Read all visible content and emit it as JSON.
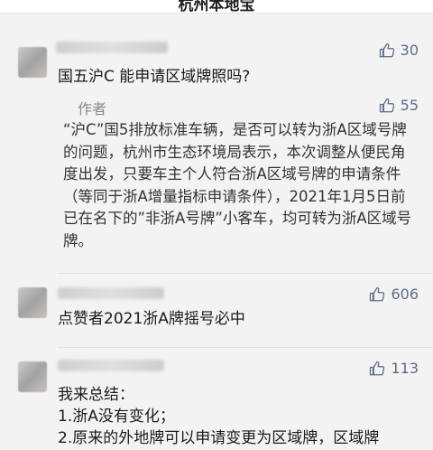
{
  "header": {
    "title": "杭州本地宝"
  },
  "comments": [
    {
      "likes": "30",
      "text": "国五沪C 能申请区域牌照吗?",
      "reply": {
        "author_label": "作者",
        "likes": "55",
        "text": "“沪C”国5排放标准车辆，是否可以转为浙A区域号牌的问题，杭州市生态环境局表示，本次调整从便民角度出发，只要车主个人符合浙A区域号牌的申请条件（等同于浙A增量指标申请条件），2021年1月5日前已在名下的”非浙A号牌”小客车，均可转为浙A区域号牌。"
      }
    },
    {
      "likes": "606",
      "text": "点赞者2021浙A牌摇号必中"
    },
    {
      "likes": "113",
      "lines": [
        "我来总结：",
        "1.浙A没有变化；",
        "2.原来的外地牌可以申请变更为区域牌，区域牌"
      ]
    }
  ],
  "icons": {
    "like": "thumbs-up-icon"
  },
  "colors": {
    "like": "#5b6c86",
    "author": "#8a8a8a",
    "background": "#f3f3f3"
  }
}
